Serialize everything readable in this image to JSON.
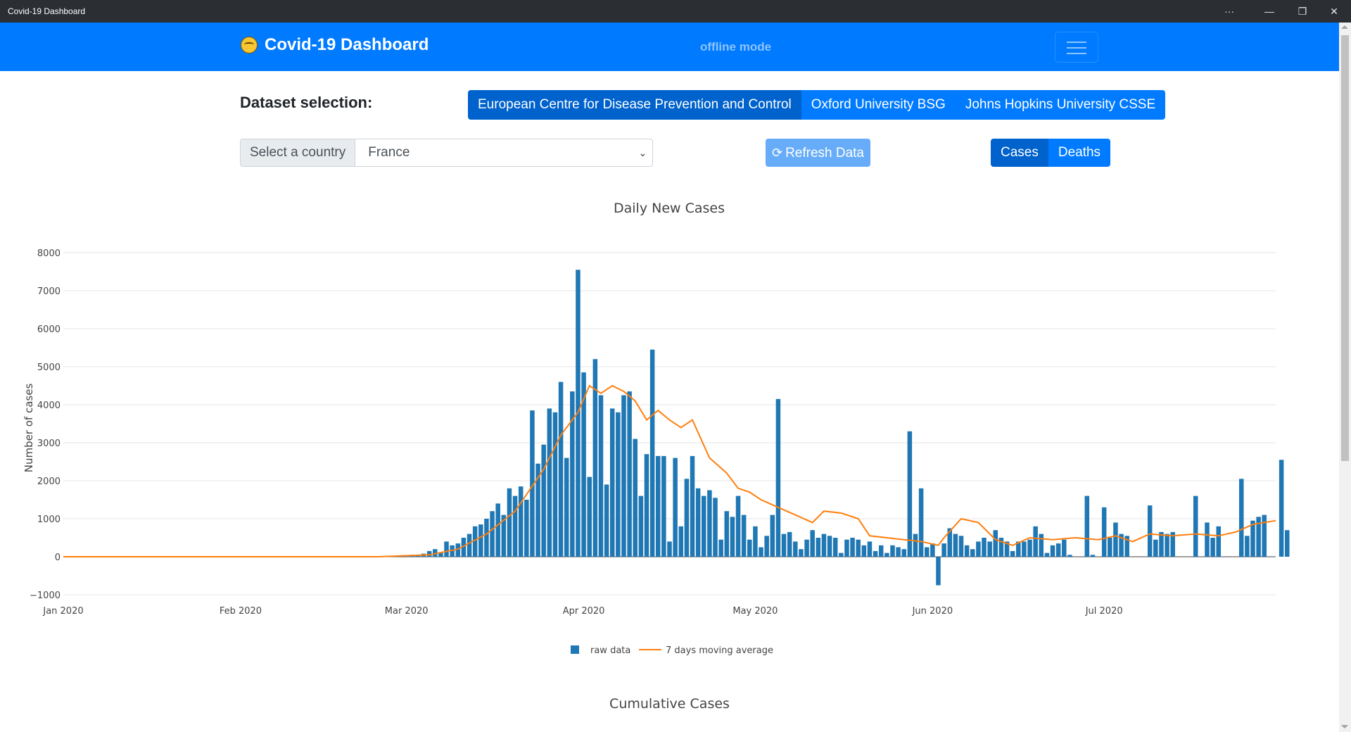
{
  "window": {
    "title": "Covid-19 Dashboard",
    "controls": [
      "···",
      "—",
      "❐",
      "✕"
    ]
  },
  "navbar": {
    "brand": "Covid-19 Dashboard",
    "status": "offline mode"
  },
  "dataset": {
    "label": "Dataset selection:",
    "options": [
      "European Centre for Disease Prevention and Control",
      "Oxford University BSG",
      "Johns Hopkins University CSSE"
    ],
    "selected": "European Centre for Disease Prevention and Control"
  },
  "country": {
    "label": "Select a country",
    "value": "France"
  },
  "refresh": {
    "label": "Refresh Data"
  },
  "metric": {
    "options": [
      "Cases",
      "Deaths"
    ],
    "selected": "Cases"
  },
  "colors": {
    "primary": "#007bff",
    "active": "#0062cc",
    "bar": "#1f77b4",
    "line": "#ff7f0e"
  },
  "chart_data": {
    "type": "bar",
    "title": "Daily New Cases",
    "xlabel": "",
    "ylabel": "Number of cases",
    "ylim": [
      -1000,
      8000
    ],
    "yticks": [
      -1000,
      0,
      1000,
      2000,
      3000,
      4000,
      5000,
      6000,
      7000,
      8000
    ],
    "ytick_labels": [
      "−1000",
      "0",
      "1000",
      "2000",
      "3000",
      "4000",
      "5000",
      "6000",
      "7000",
      "8000"
    ],
    "xticks": [
      "2020-01-01",
      "2020-02-01",
      "2020-03-01",
      "2020-04-01",
      "2020-05-01",
      "2020-06-01",
      "2020-07-01"
    ],
    "xtick_labels": [
      "Jan 2020",
      "Feb 2020",
      "Mar 2020",
      "Apr 2020",
      "May 2020",
      "Jun 2020",
      "Jul 2020"
    ],
    "xlim": [
      "2020-01-01",
      "2020-07-31"
    ],
    "grid": true,
    "legend_position": "bottom-center",
    "series": [
      {
        "name": "raw data",
        "type": "bar",
        "start_date": "2020-02-29",
        "values": [
          0,
          10,
          20,
          30,
          80,
          150,
          200,
          100,
          400,
          300,
          350,
          500,
          600,
          800,
          850,
          1000,
          1200,
          1400,
          1100,
          1800,
          1600,
          1850,
          1500,
          3850,
          2450,
          2950,
          3900,
          3800,
          4600,
          2600,
          4350,
          7550,
          4850,
          2100,
          5200,
          4250,
          1900,
          3900,
          3800,
          4250,
          4350,
          3100,
          1600,
          2700,
          5450,
          2650,
          2650,
          400,
          2600,
          800,
          2050,
          2650,
          1800,
          1600,
          1750,
          1550,
          450,
          1200,
          1050,
          1600,
          1100,
          450,
          800,
          250,
          550,
          1100,
          4150,
          600,
          650,
          400,
          200,
          450,
          700,
          500,
          600,
          550,
          500,
          100,
          450,
          500,
          450,
          300,
          400,
          150,
          300,
          100,
          300,
          250,
          200,
          3300,
          600,
          1800,
          250,
          350,
          -750,
          350,
          750,
          600,
          550,
          300,
          200,
          400,
          500,
          400,
          700,
          500,
          400,
          150,
          400,
          400,
          450,
          800,
          600,
          100,
          300,
          350,
          450,
          50,
          0,
          0,
          1600,
          50,
          0,
          1300,
          500,
          900,
          600,
          550,
          0,
          0,
          0,
          1350,
          450,
          650,
          600,
          650,
          0,
          0,
          0,
          1600,
          0,
          900,
          500,
          800,
          0,
          0,
          0,
          2050,
          550,
          950,
          1050,
          1100,
          0,
          0,
          2550,
          700
        ]
      },
      {
        "name": "7 days moving average",
        "type": "line",
        "points": [
          [
            "2020-01-01",
            0
          ],
          [
            "2020-02-25",
            0
          ],
          [
            "2020-03-05",
            50
          ],
          [
            "2020-03-10",
            200
          ],
          [
            "2020-03-15",
            600
          ],
          [
            "2020-03-20",
            1200
          ],
          [
            "2020-03-25",
            2300
          ],
          [
            "2020-03-28",
            3200
          ],
          [
            "2020-03-31",
            3800
          ],
          [
            "2020-04-02",
            4500
          ],
          [
            "2020-04-04",
            4300
          ],
          [
            "2020-04-06",
            4500
          ],
          [
            "2020-04-08",
            4350
          ],
          [
            "2020-04-10",
            4100
          ],
          [
            "2020-04-12",
            3600
          ],
          [
            "2020-04-14",
            3850
          ],
          [
            "2020-04-16",
            3600
          ],
          [
            "2020-04-18",
            3400
          ],
          [
            "2020-04-20",
            3600
          ],
          [
            "2020-04-23",
            2600
          ],
          [
            "2020-04-26",
            2200
          ],
          [
            "2020-04-28",
            1800
          ],
          [
            "2020-04-30",
            1700
          ],
          [
            "2020-05-02",
            1500
          ],
          [
            "2020-05-05",
            1300
          ],
          [
            "2020-05-08",
            1100
          ],
          [
            "2020-05-11",
            900
          ],
          [
            "2020-05-13",
            1200
          ],
          [
            "2020-05-16",
            1150
          ],
          [
            "2020-05-19",
            1000
          ],
          [
            "2020-05-21",
            550
          ],
          [
            "2020-05-24",
            500
          ],
          [
            "2020-05-27",
            450
          ],
          [
            "2020-05-30",
            400
          ],
          [
            "2020-06-02",
            300
          ],
          [
            "2020-06-03",
            500
          ],
          [
            "2020-06-06",
            1000
          ],
          [
            "2020-06-09",
            900
          ],
          [
            "2020-06-12",
            450
          ],
          [
            "2020-06-15",
            300
          ],
          [
            "2020-06-18",
            500
          ],
          [
            "2020-06-22",
            450
          ],
          [
            "2020-06-26",
            500
          ],
          [
            "2020-06-30",
            450
          ],
          [
            "2020-07-03",
            550
          ],
          [
            "2020-07-06",
            400
          ],
          [
            "2020-07-09",
            600
          ],
          [
            "2020-07-13",
            550
          ],
          [
            "2020-07-17",
            600
          ],
          [
            "2020-07-21",
            550
          ],
          [
            "2020-07-24",
            650
          ],
          [
            "2020-07-27",
            850
          ],
          [
            "2020-07-31",
            950
          ]
        ]
      }
    ]
  },
  "cumulative_title": "Cumulative Cases"
}
